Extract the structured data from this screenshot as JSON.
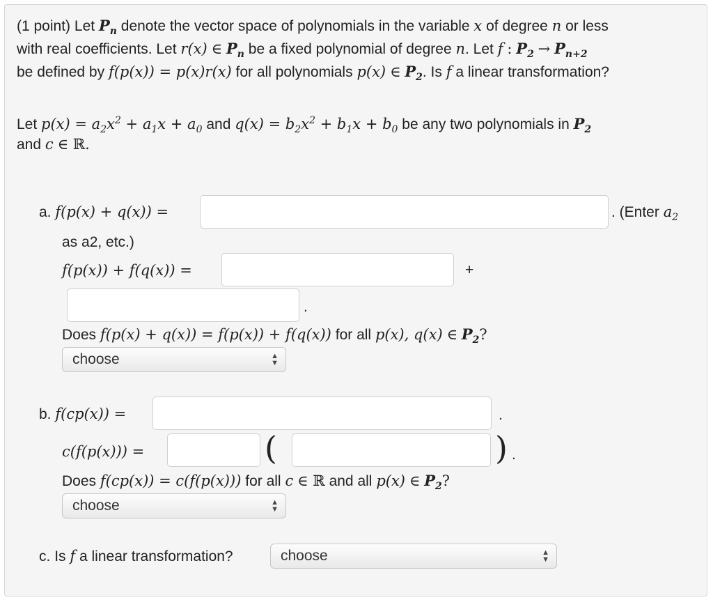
{
  "intro": {
    "point": "(1 point)",
    "let": "Let",
    "denote": "denote the vector space of polynomials in the variable",
    "of_degree": "of degree",
    "or_less": "or less",
    "line2a": "with real coefficients. Let",
    "be_fixed": "be a fixed polynomial of degree",
    "let_f": ". Let",
    "be_defined_by": "be defined by",
    "for_all_polys": "for all polynomials",
    "is_f": ". Is",
    "linear_q": "a linear transformation?"
  },
  "setup": {
    "let": "Let",
    "and": "and",
    "be_any": "be any two polynomials in",
    "and_c": "and"
  },
  "part_a": {
    "label": "a.",
    "enter_hint": ". (Enter",
    "hint_cont": "as a2, etc.)",
    "plus": "+",
    "dot": ".",
    "does": "Does",
    "for_all": "for all",
    "select_value": "choose"
  },
  "part_b": {
    "label": "b.",
    "dot": ".",
    "does": "Does",
    "for_all": "for all",
    "and_all": "and all",
    "select_value": "choose"
  },
  "part_c": {
    "label": "c.",
    "question_a": "Is",
    "question_b": "a linear transformation?",
    "select_value": "choose"
  }
}
